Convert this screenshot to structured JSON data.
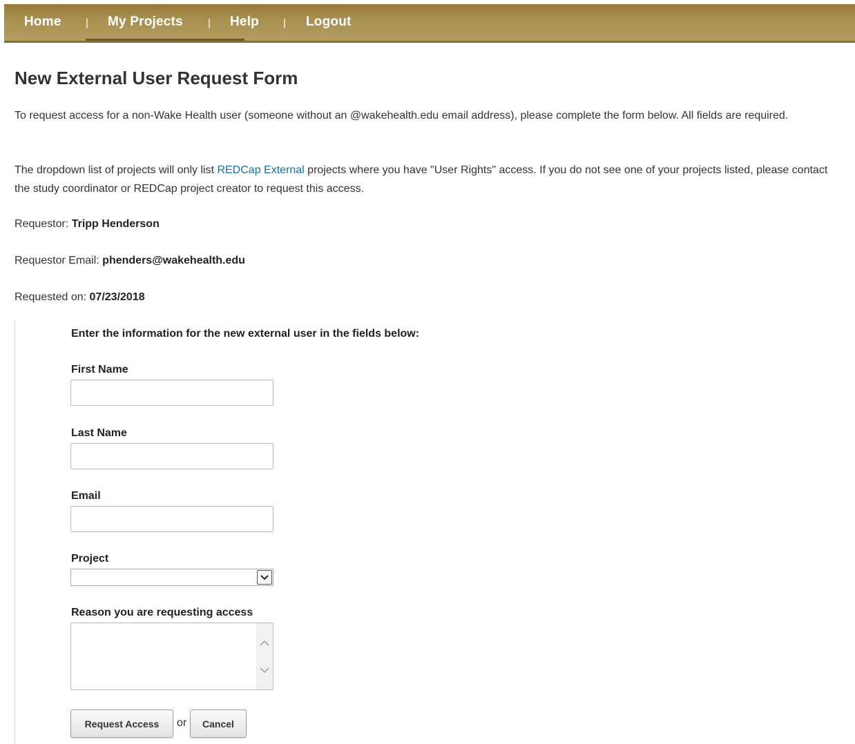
{
  "nav": {
    "items": [
      {
        "label": "Home"
      },
      {
        "label": "My Projects"
      },
      {
        "label": "Help"
      },
      {
        "label": "Logout"
      }
    ],
    "separator": "|"
  },
  "page": {
    "title": "New External User Request Form",
    "intro": "To request access for a non-Wake Health user (someone without an @wakehealth.edu email address), please complete the form below. All fields are required.",
    "dropdown_note_before": "The dropdown list of projects will only list ",
    "dropdown_note_link": "REDCap External",
    "dropdown_note_after": " projects where you have \"User Rights\" access. If you do not see one of your projects listed, please contact the study coordinator or REDCap project creator to request this access."
  },
  "requestor": {
    "name_label": "Requestor: ",
    "name": "Tripp Henderson",
    "email_label": "Requestor Email: ",
    "email": "phenders@wakehealth.edu",
    "date_label": "Requested on: ",
    "date": "07/23/2018"
  },
  "form": {
    "heading": "Enter the information for the new external user in the fields below:",
    "first_name_label": "First Name",
    "first_name_value": "",
    "last_name_label": "Last Name",
    "last_name_value": "",
    "email_label": "Email",
    "email_value": "",
    "project_label": "Project",
    "project_selected": "",
    "reason_label": "Reason you are requesting access",
    "reason_value": "",
    "submit_label": "Request Access",
    "or_text": "or",
    "cancel_label": "Cancel"
  },
  "colors": {
    "nav_background": "#a8904f",
    "link": "#1a6f9f"
  }
}
